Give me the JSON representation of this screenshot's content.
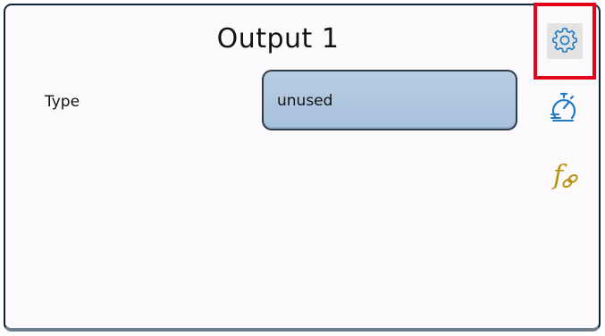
{
  "header": {
    "title": "Output 1"
  },
  "form": {
    "type_label": "Type",
    "type_value": "unused"
  },
  "sidebar": {
    "items": [
      {
        "icon": "gear-icon",
        "selected": true
      },
      {
        "icon": "stopwatch-icon",
        "selected": false
      },
      {
        "icon": "function-link-icon",
        "selected": false
      }
    ]
  },
  "colors": {
    "select_fill": "#a8c1dc",
    "icon_blue": "#1f7bc4",
    "icon_gold": "#b8930e",
    "highlight_red": "#e2001a"
  }
}
